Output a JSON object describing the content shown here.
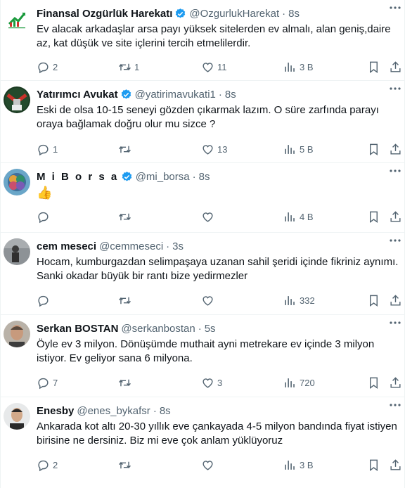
{
  "tweets": [
    {
      "name": "Finansal Ozgürlük Harekatı",
      "handle": "@OzgurlukHarekat",
      "time": "8s",
      "verified": true,
      "text": "Ev alacak arkadaşlar arsa payı yüksek sitelerden ev almalı, alan geniş,daire az, kat düşük ve site içlerini tercih etmelilerdir.",
      "replies": "2",
      "retweets": "1",
      "likes": "11",
      "views": "3 B"
    },
    {
      "name": "Yatırımcı Avukat",
      "handle": "@yatirimavukati1",
      "time": "8s",
      "verified": true,
      "text": "Eski de olsa 10-15 seneyi gözden çıkarmak lazım. O süre zarfında parayı oraya bağlamak doğru olur mu sizce ?",
      "replies": "1",
      "retweets": "",
      "likes": "13",
      "views": "5 B"
    },
    {
      "name": "M i B o r s a",
      "handle": "@mi_borsa",
      "time": "8s",
      "verified": true,
      "text": "👍",
      "replies": "",
      "retweets": "",
      "likes": "",
      "views": "4 B"
    },
    {
      "name": "cem meseci",
      "handle": "@cemmeseci",
      "time": "3s",
      "verified": false,
      "text": "Hocam, kumburgazdan selimpaşaya uzanan sahil şeridi içinde fikriniz aynımı. Sanki okadar büyük bir rantı bize yedirmezler",
      "replies": "",
      "retweets": "",
      "likes": "",
      "views": "332"
    },
    {
      "name": "Serkan BOSTAN",
      "handle": "@serkanbostan",
      "time": "5s",
      "verified": false,
      "text": "Öyle ev 3 milyon. Dönüşümde muthait ayni metrekare ev içinde 3 milyon istiyor. Ev geliyor sana 6 milyona.",
      "replies": "7",
      "retweets": "",
      "likes": "3",
      "views": "720"
    },
    {
      "name": "Enesby",
      "handle": "@enes_bykafsr",
      "time": "8s",
      "verified": false,
      "text": "Ankarada kot altı 20-30 yıllık eve çankayada 4-5 milyon bandında fiyat istiyen birisine ne dersiniz. Biz mi eve çok anlam yüklüyoruz",
      "replies": "2",
      "retweets": "",
      "likes": "",
      "views": "3 B"
    }
  ],
  "icons": {
    "reply": "reply-icon",
    "retweet": "retweet-icon",
    "like": "heart-icon",
    "views": "views-icon",
    "bookmark": "bookmark-icon",
    "share": "share-icon",
    "verified": "verified-badge-icon",
    "more": "more-options-icon"
  },
  "colors": {
    "text": "#0f1419",
    "secondary": "#536471",
    "verified": "#1d9bf0",
    "border": "#eff3f4"
  }
}
